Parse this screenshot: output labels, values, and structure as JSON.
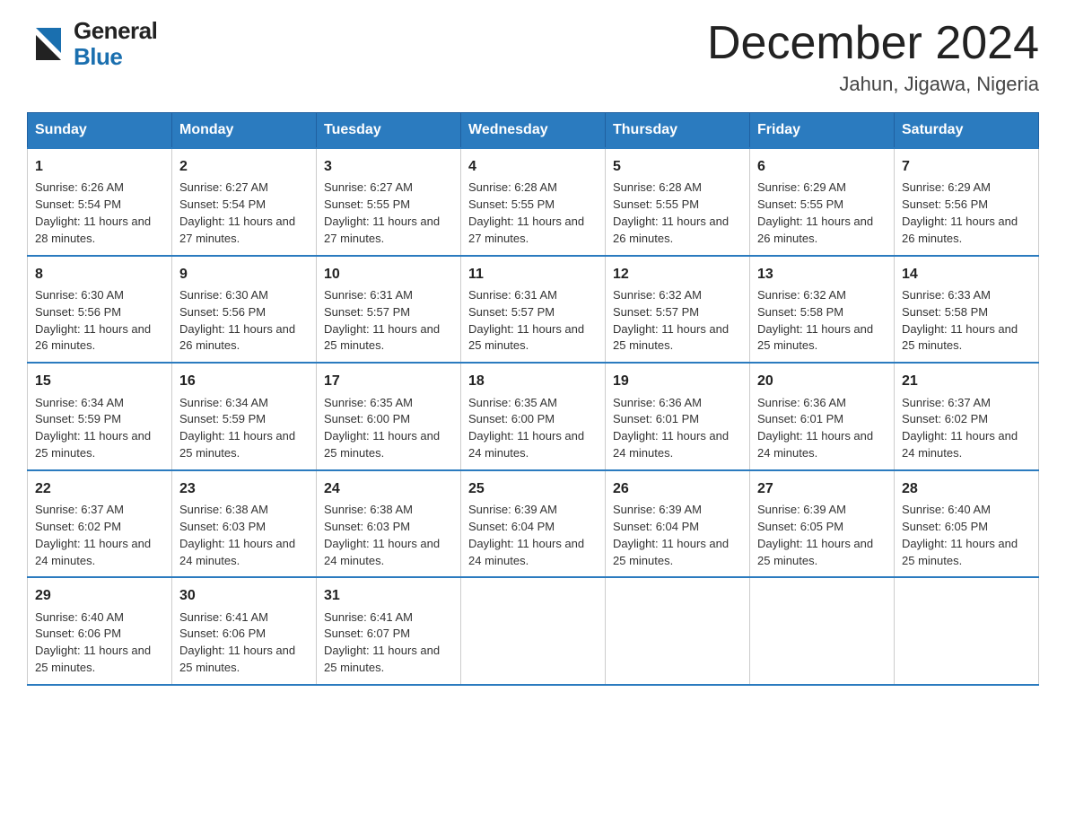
{
  "header": {
    "logo_general": "General",
    "logo_blue": "Blue",
    "month_title": "December 2024",
    "location": "Jahun, Jigawa, Nigeria"
  },
  "days_of_week": [
    "Sunday",
    "Monday",
    "Tuesday",
    "Wednesday",
    "Thursday",
    "Friday",
    "Saturday"
  ],
  "weeks": [
    [
      {
        "day": "1",
        "sunrise": "6:26 AM",
        "sunset": "5:54 PM",
        "daylight": "11 hours and 28 minutes."
      },
      {
        "day": "2",
        "sunrise": "6:27 AM",
        "sunset": "5:54 PM",
        "daylight": "11 hours and 27 minutes."
      },
      {
        "day": "3",
        "sunrise": "6:27 AM",
        "sunset": "5:55 PM",
        "daylight": "11 hours and 27 minutes."
      },
      {
        "day": "4",
        "sunrise": "6:28 AM",
        "sunset": "5:55 PM",
        "daylight": "11 hours and 27 minutes."
      },
      {
        "day": "5",
        "sunrise": "6:28 AM",
        "sunset": "5:55 PM",
        "daylight": "11 hours and 26 minutes."
      },
      {
        "day": "6",
        "sunrise": "6:29 AM",
        "sunset": "5:55 PM",
        "daylight": "11 hours and 26 minutes."
      },
      {
        "day": "7",
        "sunrise": "6:29 AM",
        "sunset": "5:56 PM",
        "daylight": "11 hours and 26 minutes."
      }
    ],
    [
      {
        "day": "8",
        "sunrise": "6:30 AM",
        "sunset": "5:56 PM",
        "daylight": "11 hours and 26 minutes."
      },
      {
        "day": "9",
        "sunrise": "6:30 AM",
        "sunset": "5:56 PM",
        "daylight": "11 hours and 26 minutes."
      },
      {
        "day": "10",
        "sunrise": "6:31 AM",
        "sunset": "5:57 PM",
        "daylight": "11 hours and 25 minutes."
      },
      {
        "day": "11",
        "sunrise": "6:31 AM",
        "sunset": "5:57 PM",
        "daylight": "11 hours and 25 minutes."
      },
      {
        "day": "12",
        "sunrise": "6:32 AM",
        "sunset": "5:57 PM",
        "daylight": "11 hours and 25 minutes."
      },
      {
        "day": "13",
        "sunrise": "6:32 AM",
        "sunset": "5:58 PM",
        "daylight": "11 hours and 25 minutes."
      },
      {
        "day": "14",
        "sunrise": "6:33 AM",
        "sunset": "5:58 PM",
        "daylight": "11 hours and 25 minutes."
      }
    ],
    [
      {
        "day": "15",
        "sunrise": "6:34 AM",
        "sunset": "5:59 PM",
        "daylight": "11 hours and 25 minutes."
      },
      {
        "day": "16",
        "sunrise": "6:34 AM",
        "sunset": "5:59 PM",
        "daylight": "11 hours and 25 minutes."
      },
      {
        "day": "17",
        "sunrise": "6:35 AM",
        "sunset": "6:00 PM",
        "daylight": "11 hours and 25 minutes."
      },
      {
        "day": "18",
        "sunrise": "6:35 AM",
        "sunset": "6:00 PM",
        "daylight": "11 hours and 24 minutes."
      },
      {
        "day": "19",
        "sunrise": "6:36 AM",
        "sunset": "6:01 PM",
        "daylight": "11 hours and 24 minutes."
      },
      {
        "day": "20",
        "sunrise": "6:36 AM",
        "sunset": "6:01 PM",
        "daylight": "11 hours and 24 minutes."
      },
      {
        "day": "21",
        "sunrise": "6:37 AM",
        "sunset": "6:02 PM",
        "daylight": "11 hours and 24 minutes."
      }
    ],
    [
      {
        "day": "22",
        "sunrise": "6:37 AM",
        "sunset": "6:02 PM",
        "daylight": "11 hours and 24 minutes."
      },
      {
        "day": "23",
        "sunrise": "6:38 AM",
        "sunset": "6:03 PM",
        "daylight": "11 hours and 24 minutes."
      },
      {
        "day": "24",
        "sunrise": "6:38 AM",
        "sunset": "6:03 PM",
        "daylight": "11 hours and 24 minutes."
      },
      {
        "day": "25",
        "sunrise": "6:39 AM",
        "sunset": "6:04 PM",
        "daylight": "11 hours and 24 minutes."
      },
      {
        "day": "26",
        "sunrise": "6:39 AM",
        "sunset": "6:04 PM",
        "daylight": "11 hours and 25 minutes."
      },
      {
        "day": "27",
        "sunrise": "6:39 AM",
        "sunset": "6:05 PM",
        "daylight": "11 hours and 25 minutes."
      },
      {
        "day": "28",
        "sunrise": "6:40 AM",
        "sunset": "6:05 PM",
        "daylight": "11 hours and 25 minutes."
      }
    ],
    [
      {
        "day": "29",
        "sunrise": "6:40 AM",
        "sunset": "6:06 PM",
        "daylight": "11 hours and 25 minutes."
      },
      {
        "day": "30",
        "sunrise": "6:41 AM",
        "sunset": "6:06 PM",
        "daylight": "11 hours and 25 minutes."
      },
      {
        "day": "31",
        "sunrise": "6:41 AM",
        "sunset": "6:07 PM",
        "daylight": "11 hours and 25 minutes."
      },
      null,
      null,
      null,
      null
    ]
  ]
}
